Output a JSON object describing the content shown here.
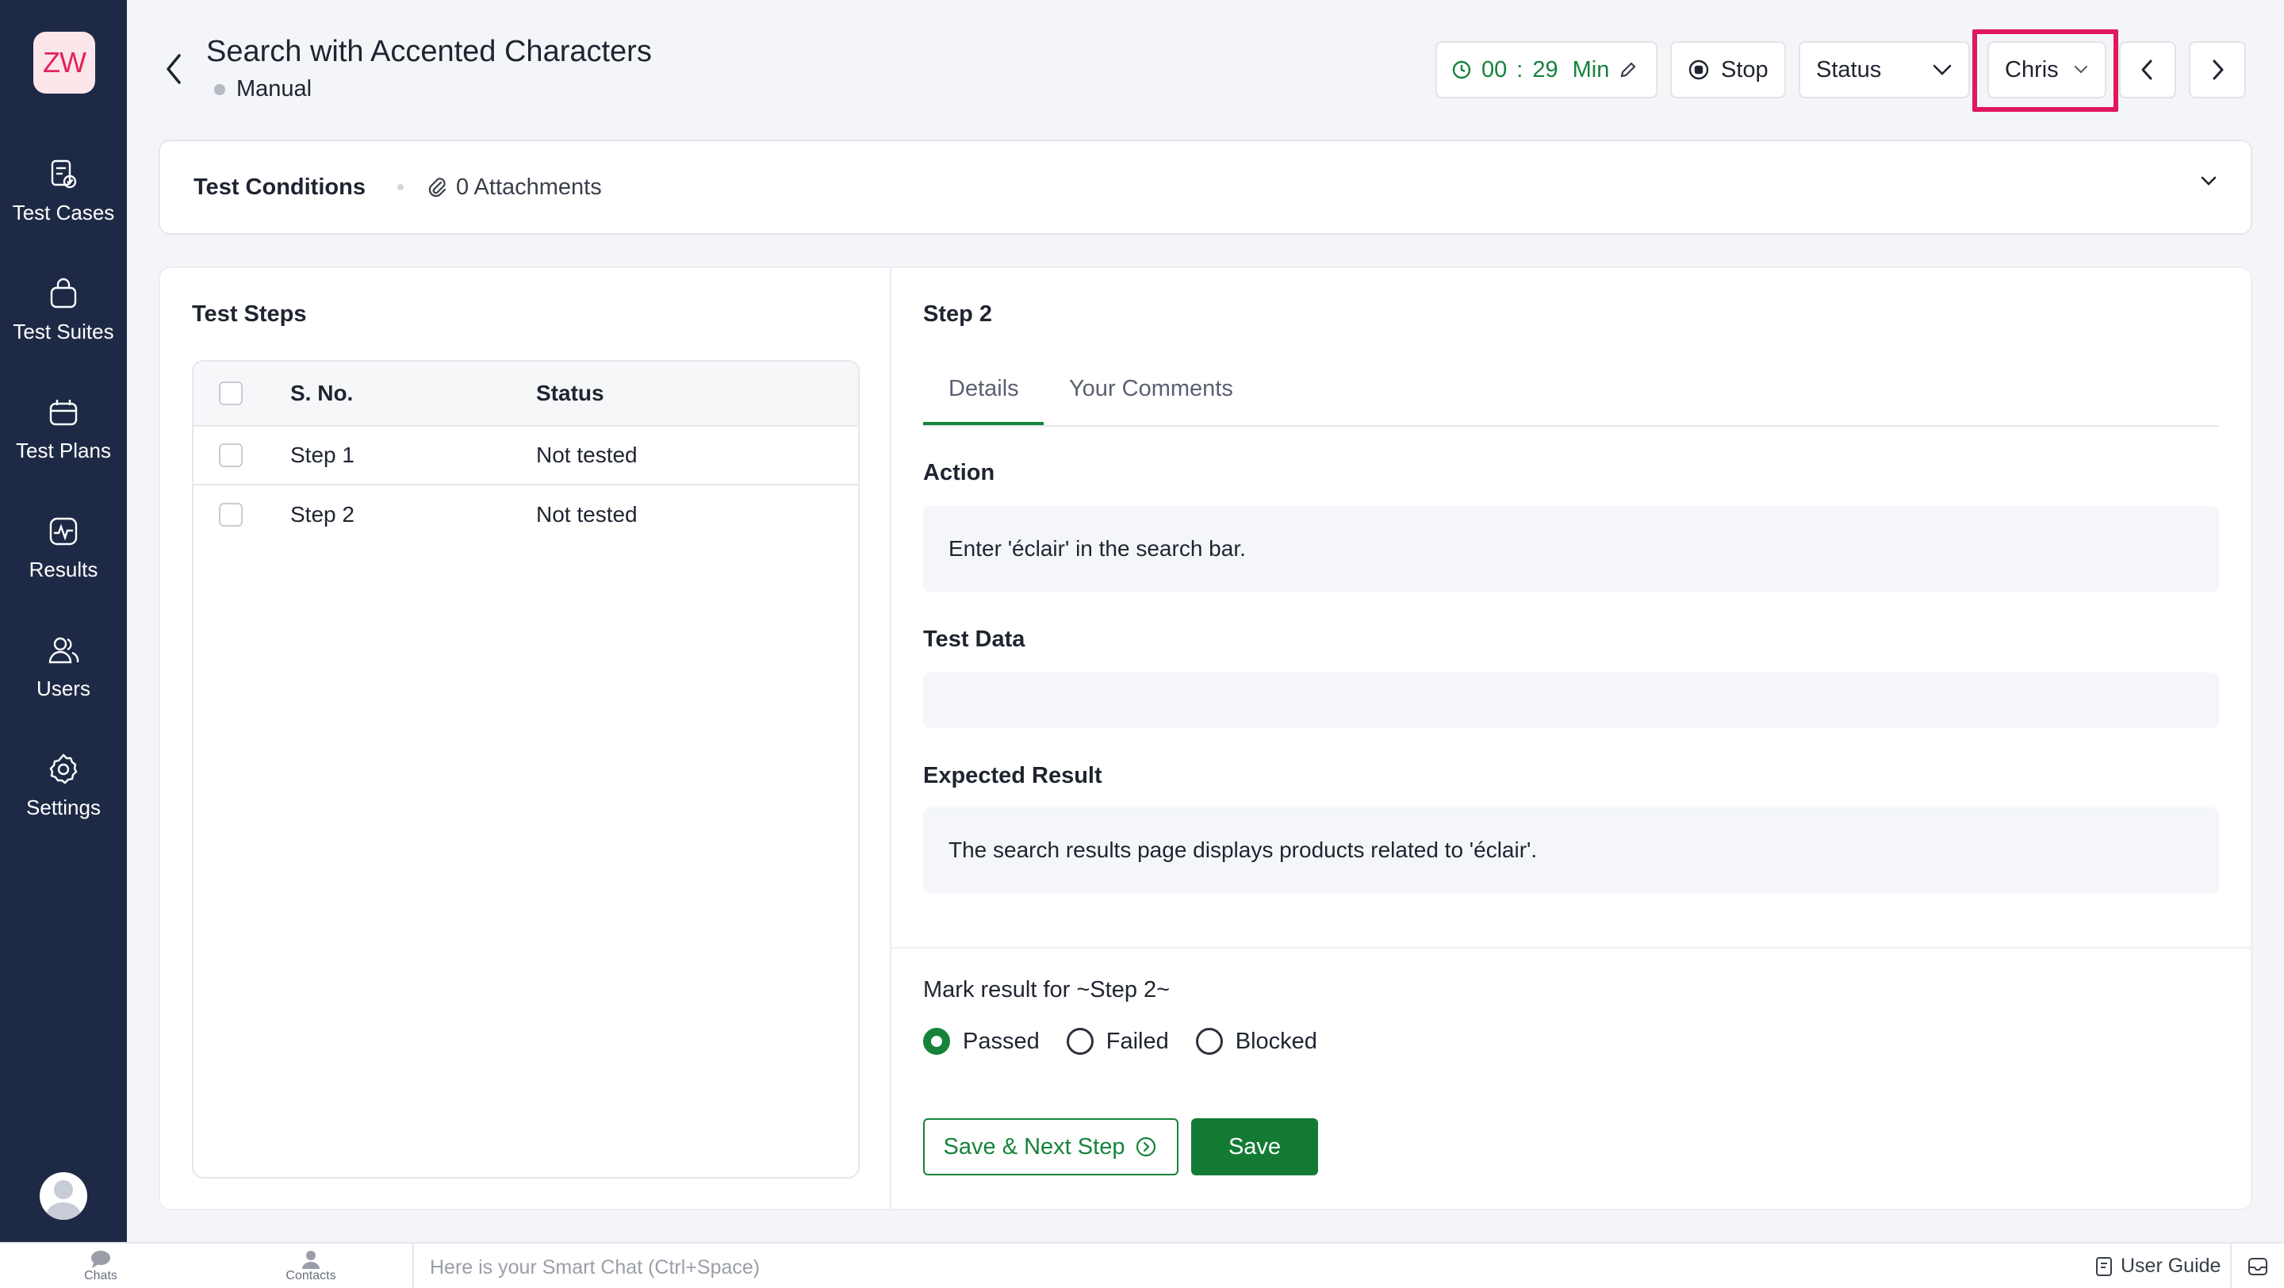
{
  "app": {
    "logo_text": "ZW"
  },
  "sidebar": {
    "items": [
      {
        "label": "Test Cases",
        "icon": "test-cases-icon"
      },
      {
        "label": "Test Suites",
        "icon": "test-suites-icon"
      },
      {
        "label": "Test Plans",
        "icon": "test-plans-icon"
      },
      {
        "label": "Results",
        "icon": "results-icon"
      },
      {
        "label": "Users",
        "icon": "users-icon"
      },
      {
        "label": "Settings",
        "icon": "settings-icon"
      }
    ]
  },
  "header": {
    "title": "Search with Accented Characters",
    "type": "Manual",
    "timer_minutes": "00",
    "timer_sep": ":",
    "timer_seconds": "29",
    "timer_unit": "Min",
    "stop_label": "Stop",
    "status_label": "Status",
    "assignee": "Chris"
  },
  "conditions": {
    "label": "Test Conditions",
    "attachments": "0 Attachments"
  },
  "steps": {
    "title": "Test Steps",
    "columns": {
      "sno": "S. No.",
      "status": "Status"
    },
    "rows": [
      {
        "sno": "Step 1",
        "status": "Not tested"
      },
      {
        "sno": "Step 2",
        "status": "Not tested"
      }
    ]
  },
  "detail": {
    "title": "Step 2",
    "tabs": [
      "Details",
      "Your Comments"
    ],
    "active_tab": "Details",
    "action_label": "Action",
    "action_value": "Enter 'éclair' in the search bar.",
    "test_data_label": "Test Data",
    "test_data_value": "",
    "expected_label": "Expected Result",
    "expected_value": "The search results page displays products related to 'éclair'.",
    "mark_label": "Mark result for ~Step 2~",
    "results": [
      "Passed",
      "Failed",
      "Blocked"
    ],
    "selected_result": "Passed",
    "save_next_label": "Save & Next Step",
    "save_label": "Save"
  },
  "bottombar": {
    "chats": "Chats",
    "contacts": "Contacts",
    "smartchat_placeholder": "Here is your Smart Chat (Ctrl+Space)",
    "user_guide": "User Guide"
  },
  "colors": {
    "sidebar_bg": "#1e2a45",
    "accent_green": "#16833b",
    "highlight": "#e0185e"
  }
}
